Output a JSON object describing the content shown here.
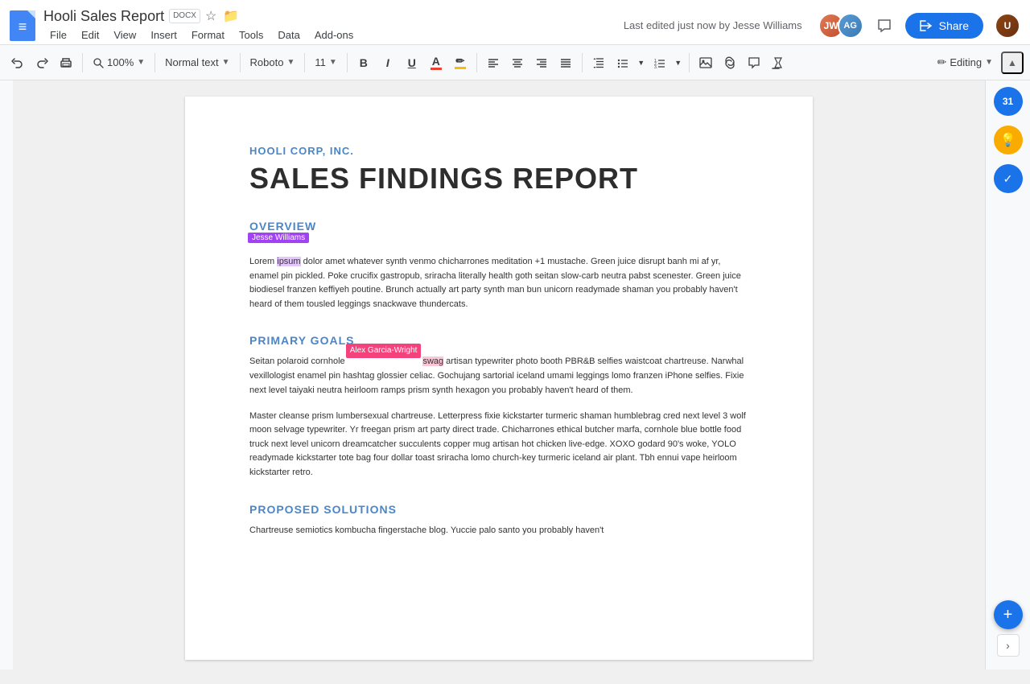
{
  "titleBar": {
    "docTitle": "Hooli Sales Report",
    "docxBadge": "DOCX",
    "lastEdited": "Last edited just now by Jesse Williams",
    "shareLabel": "Share",
    "menuItems": [
      "File",
      "Edit",
      "View",
      "Insert",
      "Format",
      "Tools",
      "Data",
      "Add-ons"
    ]
  },
  "toolbar": {
    "undoLabel": "↺",
    "redoLabel": "↻",
    "printLabel": "🖨",
    "zoomLabel": "100%",
    "styleLabel": "Normal text",
    "fontLabel": "Roboto",
    "sizeLabel": "11",
    "boldLabel": "B",
    "italicLabel": "I",
    "underlineLabel": "U",
    "textColorLabel": "A",
    "highlightLabel": "✏",
    "alignLeftLabel": "≡",
    "alignCenterLabel": "≡",
    "alignRightLabel": "≡",
    "alignJustifyLabel": "≡",
    "lineSpacingLabel": "↕",
    "listBulletLabel": "≡",
    "listNumberLabel": "≡",
    "insertImageLabel": "🖼",
    "insertLinkLabel": "🔗",
    "editingLabel": "Editing",
    "collapseLabel": "▲"
  },
  "document": {
    "companyName": "HOOLI CORP, INC.",
    "mainTitle": "SALES FINDINGS REPORT",
    "sections": [
      {
        "id": "overview",
        "heading": "OVERVIEW",
        "paragraphs": [
          "Lorem ipsum dolor amet whatever synth venmo chicharrones meditation +1 mustache. Green juice disrupt banh mi af yr, enamel pin pickled. Poke crucifix gastropub, sriracha literally health goth seitan slow-carb neutra pabst scenester. Green juice biodiesel franzen keffiyeh poutine. Brunch actually art party synth man bun unicorn readymade shaman you probably haven't heard of them tousled leggings snackwave thundercats."
        ],
        "cursor": {
          "user": "Jesse Williams",
          "color": "#a142f4",
          "position": "ipsum"
        }
      },
      {
        "id": "primary-goals",
        "heading": "PRIMARY GOALS",
        "paragraphs": [
          "Seitan polaroid cornhole swag artisan typewriter photo booth PBR&B selfies waistcoat chartreuse. Narwhal vexillologist enamel pin hashtag glossier celiac. Gochujang sartorial iceland umami leggings lomo franzen iPhone selfies. Fixie next level taiyaki neutra heirloom ramps prism synth hexagon you probably haven't heard of them.",
          "Master cleanse prism lumbersexual chartreuse. Letterpress fixie kickstarter turmeric shaman humblebrag cred next level 3 wolf moon selvage typewriter. Yr freegan prism art party direct trade. Chicharrones ethical butcher marfa, cornhole blue bottle food truck next level unicorn dreamcatcher succulents copper mug artisan hot chicken live-edge. XOXO godard 90's woke, YOLO readymade kickstarter tote bag four dollar toast sriracha lomo church-key turmeric iceland air plant. Tbh ennui vape heirloom kickstarter retro."
        ],
        "cursor": {
          "user": "Alex Garcia-Wright",
          "color": "#f4427c",
          "position": "swag"
        }
      },
      {
        "id": "proposed-solutions",
        "heading": "PROPOSED SOLUTIONS",
        "paragraphs": [
          "Chartreuse semiotics kombucha fingerstache blog. Yuccie palo santo you probably haven't"
        ]
      }
    ]
  },
  "rightSidebar": {
    "calendarLabel": "31",
    "lightbulbLabel": "💡",
    "checkLabel": "✓"
  },
  "bottomButtons": {
    "addCommentLabel": "+",
    "expandLabel": "›"
  }
}
